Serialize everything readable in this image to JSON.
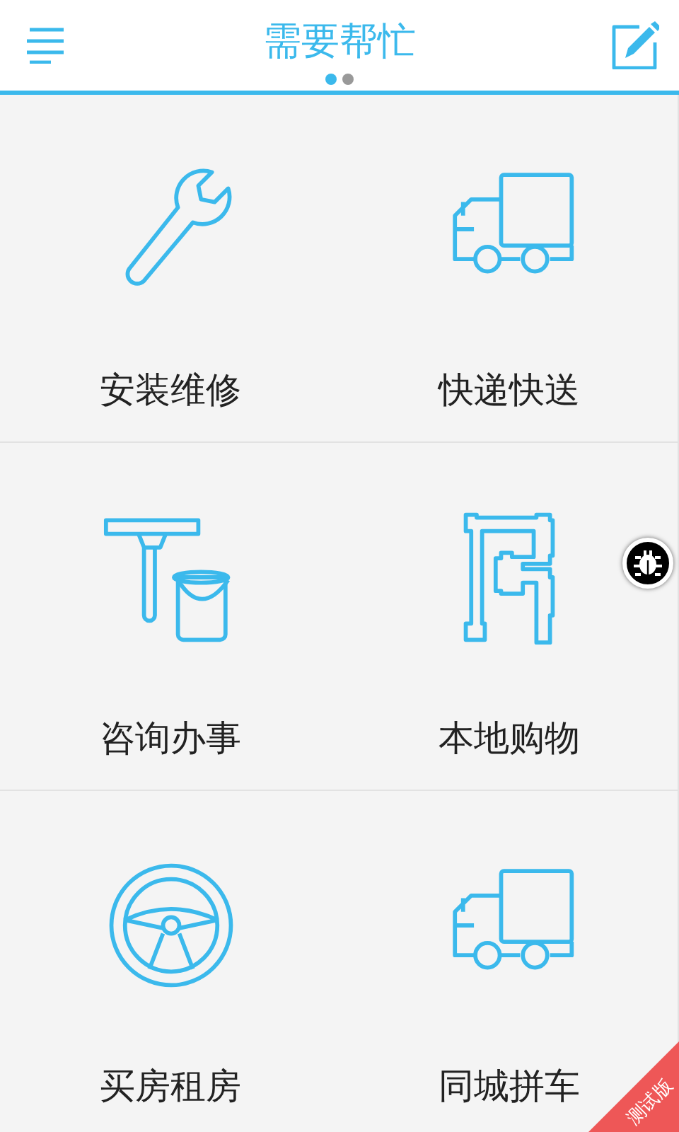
{
  "header": {
    "title": "需要帮忙",
    "page_dots": [
      {
        "selected": true
      },
      {
        "selected": false
      }
    ]
  },
  "tiles": [
    {
      "label": "安装维修",
      "kind": "wrench"
    },
    {
      "label": "快递快送",
      "kind": "truck"
    },
    {
      "label": "咨询办事",
      "kind": "squeegee"
    },
    {
      "label": "本地购物",
      "kind": "pipe"
    },
    {
      "label": "买房租房",
      "kind": "wheel"
    },
    {
      "label": "同城拼车",
      "kind": "truck"
    }
  ],
  "corner_ribbon": {
    "text": "测试版"
  }
}
